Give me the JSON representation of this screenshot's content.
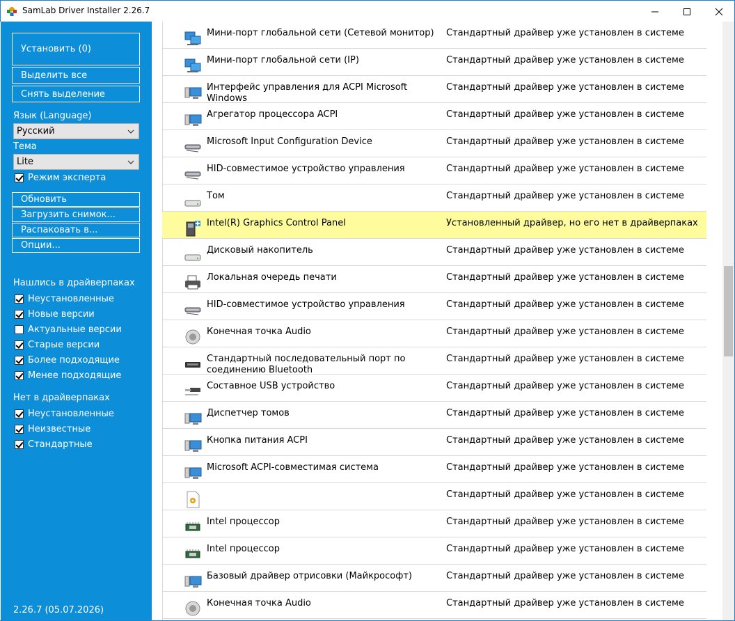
{
  "window": {
    "title": "SamLab Driver Installer 2.26.7",
    "icon": "samlab-app-icon",
    "controls": {
      "minimize": "—",
      "maximize": "☐",
      "close": "✕"
    }
  },
  "sidebar": {
    "install_button": "Установить (0)",
    "select_all": "Выделить все",
    "deselect": "Снять выделение",
    "language_label": "Язык (Language)",
    "language_value": "Русский",
    "theme_label": "Тема",
    "theme_value": "Lite",
    "expert_mode": "Режим эксперта",
    "refresh": "Обновить",
    "load_snapshot": "Загрузить снимок...",
    "unpack_to": "Распаковать в...",
    "options": "Опции...",
    "found_header": "Нашлись в драйверпаках",
    "found_items": [
      {
        "label": "Неустановленные",
        "checked": true
      },
      {
        "label": "Новые версии",
        "checked": true
      },
      {
        "label": "Актуальные версии",
        "checked": false
      },
      {
        "label": "Старые версии",
        "checked": true
      },
      {
        "label": "Более подходящие",
        "checked": true
      },
      {
        "label": "Менее подходящие",
        "checked": true
      }
    ],
    "notfound_header": "Нет в драйверпаках",
    "notfound_items": [
      {
        "label": "Неустановленные",
        "checked": true
      },
      {
        "label": "Неизвестные",
        "checked": true
      },
      {
        "label": "Стандартные",
        "checked": true
      }
    ],
    "version": "2.26.7 (05.07.2026)"
  },
  "drivers": [
    {
      "name": "Мини-порт глобальной сети (Сетевой монитор)",
      "status": "Стандартный драйвер уже установлен в системе",
      "icon": "network-icon"
    },
    {
      "name": "Мини-порт глобальной сети (IP)",
      "status": "Стандартный драйвер уже установлен в системе",
      "icon": "network-icon"
    },
    {
      "name": "Интерфейс управления для ACPI Microsoft Windows",
      "status": "Стандартный драйвер уже установлен в системе",
      "icon": "computer-icon"
    },
    {
      "name": "Агрегатор процессора ACPI",
      "status": "Стандартный драйвер уже установлен в системе",
      "icon": "computer-icon"
    },
    {
      "name": "Microsoft Input Configuration Device",
      "status": "Стандартный драйвер уже установлен в системе",
      "icon": "hid-icon"
    },
    {
      "name": "HID-совместимое устройство управления",
      "status": "Стандартный драйвер уже установлен в системе",
      "icon": "hid-icon"
    },
    {
      "name": "Том",
      "status": "Стандартный драйвер уже установлен в системе",
      "icon": "drive-icon"
    },
    {
      "name": "Intel(R) Graphics Control Panel",
      "status": "Установленный драйвер, но его нет в драйверпаках",
      "icon": "component-icon",
      "highlight": true
    },
    {
      "name": "Дисковый накопитель",
      "status": "Стандартный драйвер уже установлен в системе",
      "icon": "drive-icon"
    },
    {
      "name": "Локальная очередь печати",
      "status": "Стандартный драйвер уже установлен в системе",
      "icon": "printer-icon"
    },
    {
      "name": "HID-совместимое устройство управления",
      "status": "Стандартный драйвер уже установлен в системе",
      "icon": "hid-icon"
    },
    {
      "name": "Конечная точка Audio",
      "status": "Стандартный драйвер уже установлен в системе",
      "icon": "speaker-icon"
    },
    {
      "name": "Стандартный последовательный порт по соединению Bluetooth",
      "status": "Стандартный драйвер уже установлен в системе",
      "icon": "port-icon"
    },
    {
      "name": "Составное USB устройство",
      "status": "Стандартный драйвер уже установлен в системе",
      "icon": "usb-icon"
    },
    {
      "name": "Диспетчер томов",
      "status": "Стандартный драйвер уже установлен в системе",
      "icon": "computer-icon"
    },
    {
      "name": "Кнопка питания ACPI",
      "status": "Стандартный драйвер уже установлен в системе",
      "icon": "computer-icon"
    },
    {
      "name": "Microsoft ACPI-совместимая система",
      "status": "Стандартный драйвер уже установлен в системе",
      "icon": "computer-icon"
    },
    {
      "name": "",
      "status": "Стандартный драйвер уже установлен в системе",
      "icon": "settings-file-icon"
    },
    {
      "name": "Intel процессор",
      "status": "Стандартный драйвер уже установлен в системе",
      "icon": "cpu-icon"
    },
    {
      "name": "Intel процессор",
      "status": "Стандартный драйвер уже установлен в системе",
      "icon": "cpu-icon"
    },
    {
      "name": "Базовый драйвер отрисовки (Майкрософт)",
      "status": "Стандартный драйвер уже установлен в системе",
      "icon": "computer-icon"
    },
    {
      "name": "Конечная точка Audio",
      "status": "Стандартный драйвер уже установлен в системе",
      "icon": "speaker-icon"
    }
  ]
}
